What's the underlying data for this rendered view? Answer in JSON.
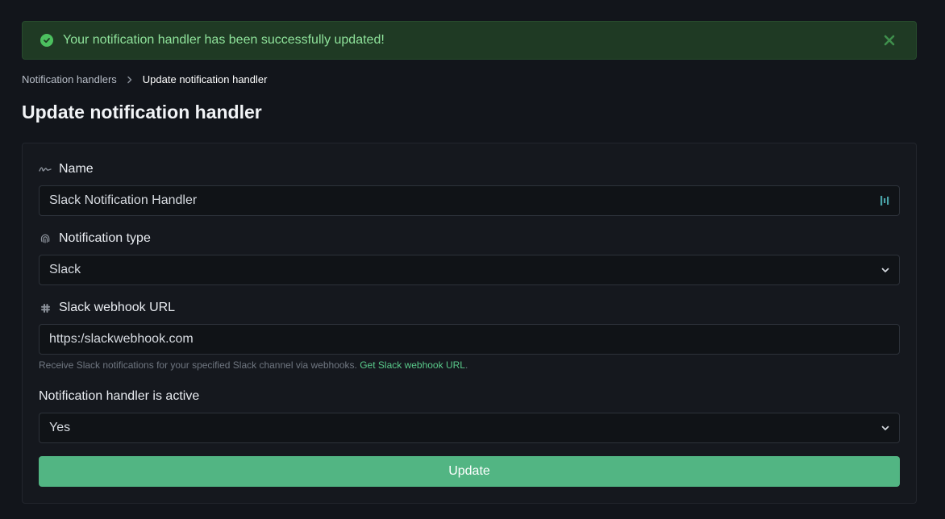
{
  "alert": {
    "message": "Your notification handler has been successfully updated!",
    "icon": "check-circle-icon",
    "close_icon": "close-icon",
    "color": "#8fe39b"
  },
  "breadcrumb": {
    "parent": "Notification handlers",
    "current": "Update notification handler"
  },
  "page_title": "Update notification handler",
  "form": {
    "name": {
      "label": "Name",
      "icon": "signature-icon",
      "value": "Slack Notification Handler"
    },
    "type": {
      "label": "Notification type",
      "icon": "fingerprint-icon",
      "value": "Slack"
    },
    "webhook": {
      "label": "Slack webhook URL",
      "icon": "slack-icon",
      "value": "https:/slackwebhook.com",
      "help_text": "Receive Slack notifications for your specified Slack channel via webhooks.",
      "help_link": "Get Slack webhook URL",
      "help_end": "."
    },
    "active": {
      "label": "Notification handler is active",
      "value": "Yes"
    },
    "submit_label": "Update"
  },
  "colors": {
    "accent": "#52b583",
    "success_bg": "#1f3a24"
  }
}
